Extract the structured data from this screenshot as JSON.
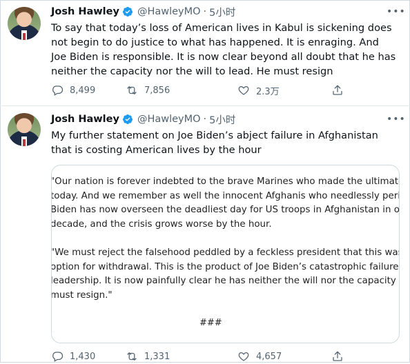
{
  "tweets": [
    {
      "author_name": "Josh Hawley",
      "handle": "@HawleyMO",
      "separator": "·",
      "time": "5小时",
      "text": "To say that today’s loss of American lives in Kabul is sickening does not begin to do justice to what has happened. It is enraging. And Joe Biden is responsible. It is now clear beyond all doubt that he has neither the capacity nor the will to lead. He must resign",
      "replies": "8,499",
      "retweets": "7,856",
      "likes": "2.3万"
    },
    {
      "author_name": "Josh Hawley",
      "handle": "@HawleyMO",
      "separator": "·",
      "time": "5小时",
      "text": "My further statement on Joe Biden’s abject failure in Afghanistan that is costing American lives by the hour",
      "quote_lines_p1": [
        "\"Our nation is forever indebted to the brave Marines who made the ultimate sacrifice",
        "today. And we remember as well the innocent Afghanis who needlessly perished. Joe",
        "Biden has now overseen the deadliest day for US troops in Afghanistan in over a",
        "decade, and the crisis grows worse by the hour."
      ],
      "quote_lines_p2": [
        "\"We must reject the falsehood peddled by a feckless president that this was the only",
        "option for withdrawal. This is the product of Joe Biden’s catastrophic failure of",
        "leadership. It is now painfully clear he has neither the will nor the capacity to lead. He",
        "must resign.\""
      ],
      "quote_end": "###",
      "replies": "1,430",
      "retweets": "1,331",
      "likes": "4,657"
    }
  ],
  "icons": {
    "verified": "verified-badge-icon",
    "reply": "reply-icon",
    "retweet": "retweet-icon",
    "like": "heart-icon",
    "share": "share-icon",
    "more": "more-icon"
  },
  "colors": {
    "verified": "#1d9bf0",
    "text": "#0f1419",
    "secondary": "#536471",
    "border": "#cfd9de"
  }
}
